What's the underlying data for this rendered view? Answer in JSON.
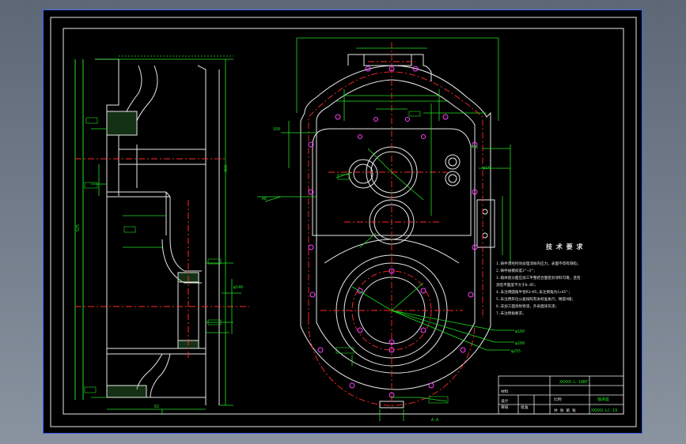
{
  "title_block": {
    "code_top": "XXXXX-L-18NT",
    "part_name": "轴承座",
    "drawing_no": "XXXXX-LC-19",
    "scale_label": "比例",
    "sheet_label": "共 张 第 张",
    "material_label": "材料",
    "designer_label": "设计",
    "checker_label": "审核",
    "approval_label": "批准"
  },
  "tech_req": {
    "title": "技 术 要 求",
    "items": [
      "1.铸件须经时效处理消除内应力，表面不得有缺陷；",
      "2.铸件拔模斜度2°~3°；",
      "3.箱体剖分面应加工平整结合面密封涂料可靠，且检",
      "  测后平面度不大于0.05；",
      "4.未注明圆角半径R3~R5,未注倒角为1×45°；",
      "5.未注明形位公差按照有关标准执行，精度9级；",
      "6.非加工面涂防锈漆，外表面涂灰漆；",
      "7.未注倒角要求。"
    ]
  },
  "dims": {
    "d1": "φ140",
    "d2": "φ160",
    "d3": "φ200",
    "d4": "φ255",
    "d5": "460",
    "d6": "525",
    "d7": "82",
    "d8": "160",
    "d9": "R8",
    "d10": "M16",
    "d11": "φ14",
    "d12": "A-A"
  },
  "colors": {
    "border": "#3a66ff",
    "outline": "#e8e8e8",
    "center": "#ff2a2a",
    "dimension": "#1fe01f"
  }
}
